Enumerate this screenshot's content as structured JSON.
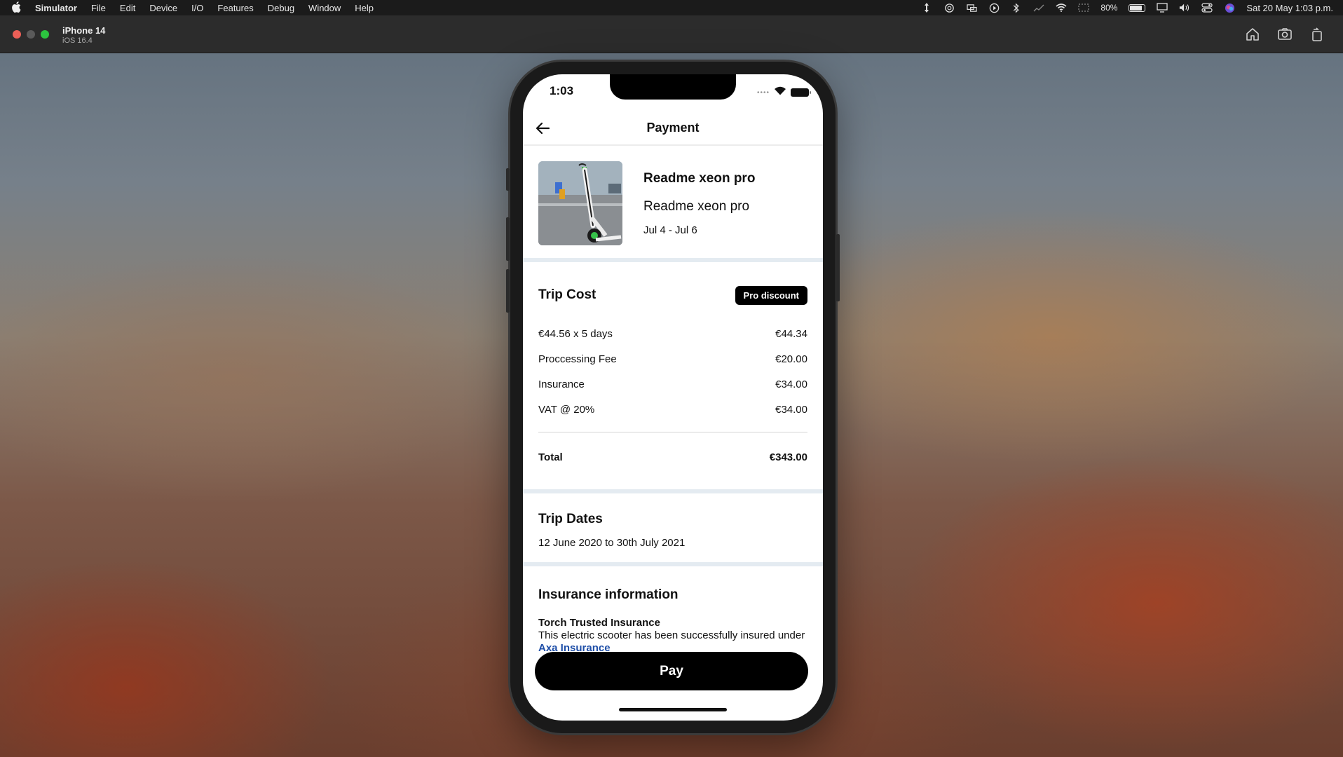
{
  "menubar": {
    "app_name": "Simulator",
    "items": [
      "File",
      "Edit",
      "Device",
      "I/O",
      "Features",
      "Debug",
      "Window",
      "Help"
    ],
    "battery": "80%",
    "datetime": "Sat 20 May  1:03 p.m."
  },
  "simulator": {
    "device": "iPhone 14",
    "os": "iOS 16.4"
  },
  "phone": {
    "status_time": "1:03",
    "nav_title": "Payment",
    "product": {
      "name": "Readme xeon pro",
      "subtitle": "Readme xeon pro",
      "dates": "Jul 4 - Jul 6"
    },
    "trip_cost": {
      "title": "Trip Cost",
      "badge": "Pro discount",
      "rows": [
        {
          "label": "€44.56 x 5 days",
          "value": "€44.34"
        },
        {
          "label": "Proccessing Fee",
          "value": "€20.00"
        },
        {
          "label": "Insurance",
          "value": "€34.00"
        },
        {
          "label": "VAT @ 20%",
          "value": "€34.00"
        }
      ],
      "total_label": "Total",
      "total_value": "€343.00"
    },
    "trip_dates": {
      "title": "Trip Dates",
      "value": "12 June 2020 to 30th July 2021"
    },
    "insurance": {
      "title": "Insurance information",
      "provider": "Torch Trusted Insurance",
      "text": "This electric scooter has been successfully insured under",
      "link": "Axa Insurance"
    },
    "pay_label": "Pay"
  }
}
